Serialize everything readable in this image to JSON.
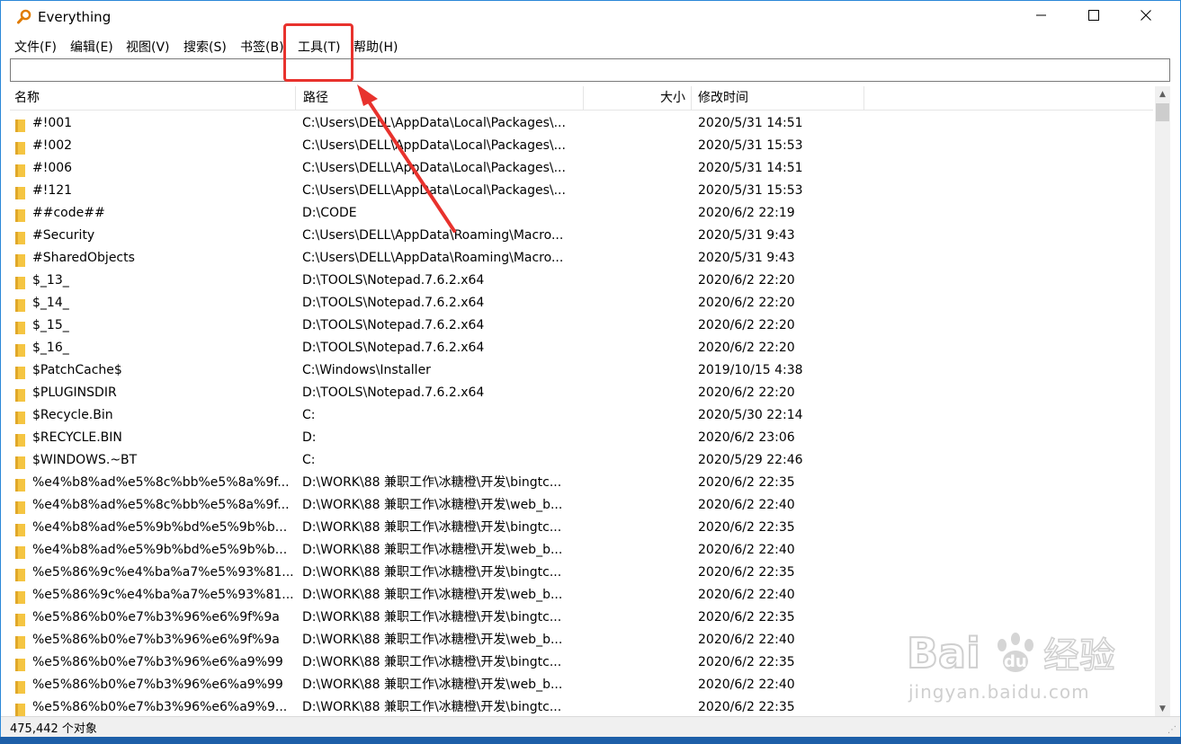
{
  "window": {
    "title": "Everything",
    "controls": [
      "minimize-icon",
      "maximize-icon",
      "close-icon"
    ]
  },
  "menu": [
    {
      "label": "文件(F)"
    },
    {
      "label": "编辑(E)"
    },
    {
      "label": "视图(V)"
    },
    {
      "label": "搜索(S)"
    },
    {
      "label": "书签(B)"
    },
    {
      "label": "工具(T)"
    },
    {
      "label": "帮助(H)"
    }
  ],
  "search": {
    "value": "",
    "placeholder": ""
  },
  "columns": {
    "name": "名称",
    "path": "路径",
    "size": "大小",
    "modified": "修改时间"
  },
  "rows": [
    {
      "name": "#!001",
      "path": "C:\\Users\\DELL\\AppData\\Local\\Packages\\...",
      "size": "",
      "modified": "2020/5/31 14:51"
    },
    {
      "name": "#!002",
      "path": "C:\\Users\\DELL\\AppData\\Local\\Packages\\...",
      "size": "",
      "modified": "2020/5/31 15:53"
    },
    {
      "name": "#!006",
      "path": "C:\\Users\\DELL\\AppData\\Local\\Packages\\...",
      "size": "",
      "modified": "2020/5/31 14:51"
    },
    {
      "name": "#!121",
      "path": "C:\\Users\\DELL\\AppData\\Local\\Packages\\...",
      "size": "",
      "modified": "2020/5/31 15:53"
    },
    {
      "name": "##code##",
      "path": "D:\\CODE",
      "size": "",
      "modified": "2020/6/2 22:19"
    },
    {
      "name": "#Security",
      "path": "C:\\Users\\DELL\\AppData\\Roaming\\Macro...",
      "size": "",
      "modified": "2020/5/31 9:43"
    },
    {
      "name": "#SharedObjects",
      "path": "C:\\Users\\DELL\\AppData\\Roaming\\Macro...",
      "size": "",
      "modified": "2020/5/31 9:43"
    },
    {
      "name": "$_13_",
      "path": "D:\\TOOLS\\Notepad.7.6.2.x64",
      "size": "",
      "modified": "2020/6/2 22:20"
    },
    {
      "name": "$_14_",
      "path": "D:\\TOOLS\\Notepad.7.6.2.x64",
      "size": "",
      "modified": "2020/6/2 22:20"
    },
    {
      "name": "$_15_",
      "path": "D:\\TOOLS\\Notepad.7.6.2.x64",
      "size": "",
      "modified": "2020/6/2 22:20"
    },
    {
      "name": "$_16_",
      "path": "D:\\TOOLS\\Notepad.7.6.2.x64",
      "size": "",
      "modified": "2020/6/2 22:20"
    },
    {
      "name": "$PatchCache$",
      "path": "C:\\Windows\\Installer",
      "size": "",
      "modified": "2019/10/15 4:38"
    },
    {
      "name": "$PLUGINSDIR",
      "path": "D:\\TOOLS\\Notepad.7.6.2.x64",
      "size": "",
      "modified": "2020/6/2 22:20"
    },
    {
      "name": "$Recycle.Bin",
      "path": "C:",
      "size": "",
      "modified": "2020/5/30 22:14"
    },
    {
      "name": "$RECYCLE.BIN",
      "path": "D:",
      "size": "",
      "modified": "2020/6/2 23:06"
    },
    {
      "name": "$WINDOWS.~BT",
      "path": "C:",
      "size": "",
      "modified": "2020/5/29 22:46"
    },
    {
      "name": "%e4%b8%ad%e5%8c%bb%e5%8a%9f...",
      "path": "D:\\WORK\\88 兼职工作\\冰糖橙\\开发\\bingtc...",
      "size": "",
      "modified": "2020/6/2 22:35"
    },
    {
      "name": "%e4%b8%ad%e5%8c%bb%e5%8a%9f...",
      "path": "D:\\WORK\\88 兼职工作\\冰糖橙\\开发\\web_b...",
      "size": "",
      "modified": "2020/6/2 22:40"
    },
    {
      "name": "%e4%b8%ad%e5%9b%bd%e5%9b%b...",
      "path": "D:\\WORK\\88 兼职工作\\冰糖橙\\开发\\bingtc...",
      "size": "",
      "modified": "2020/6/2 22:35"
    },
    {
      "name": "%e4%b8%ad%e5%9b%bd%e5%9b%b...",
      "path": "D:\\WORK\\88 兼职工作\\冰糖橙\\开发\\web_b...",
      "size": "",
      "modified": "2020/6/2 22:40"
    },
    {
      "name": "%e5%86%9c%e4%ba%a7%e5%93%81...",
      "path": "D:\\WORK\\88 兼职工作\\冰糖橙\\开发\\bingtc...",
      "size": "",
      "modified": "2020/6/2 22:35"
    },
    {
      "name": "%e5%86%9c%e4%ba%a7%e5%93%81...",
      "path": "D:\\WORK\\88 兼职工作\\冰糖橙\\开发\\web_b...",
      "size": "",
      "modified": "2020/6/2 22:40"
    },
    {
      "name": "%e5%86%b0%e7%b3%96%e6%9f%9a",
      "path": "D:\\WORK\\88 兼职工作\\冰糖橙\\开发\\bingtc...",
      "size": "",
      "modified": "2020/6/2 22:35"
    },
    {
      "name": "%e5%86%b0%e7%b3%96%e6%9f%9a",
      "path": "D:\\WORK\\88 兼职工作\\冰糖橙\\开发\\web_b...",
      "size": "",
      "modified": "2020/6/2 22:40"
    },
    {
      "name": "%e5%86%b0%e7%b3%96%e6%a9%99",
      "path": "D:\\WORK\\88 兼职工作\\冰糖橙\\开发\\bingtc...",
      "size": "",
      "modified": "2020/6/2 22:35"
    },
    {
      "name": "%e5%86%b0%e7%b3%96%e6%a9%99",
      "path": "D:\\WORK\\88 兼职工作\\冰糖橙\\开发\\web_b...",
      "size": "",
      "modified": "2020/6/2 22:40"
    },
    {
      "name": "%e5%86%b0%e7%b3%96%e6%a9%9...",
      "path": "D:\\WORK\\88 兼职工作\\冰糖橙\\开发\\bingtc...",
      "size": "",
      "modified": "2020/6/2 22:35"
    }
  ],
  "status": {
    "count": "475,442 个对象"
  },
  "annotation": {
    "color": "#e8322d"
  },
  "watermark": {
    "brand": "Bai du 经验",
    "url": "jingyan.baidu.com"
  },
  "colors": {
    "folder": "#f5c542",
    "accent_border": "#2b88d8",
    "taskbar": "#1d5fa8"
  }
}
